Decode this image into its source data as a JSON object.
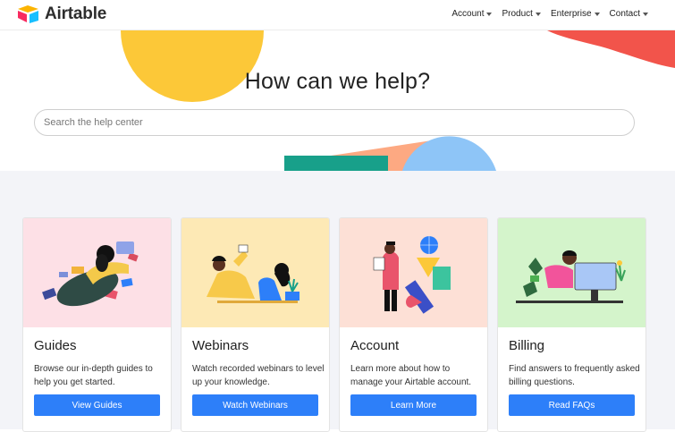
{
  "brand": {
    "name": "Airtable"
  },
  "nav": {
    "items": [
      {
        "label": "Account"
      },
      {
        "label": "Product"
      },
      {
        "label": "Enterprise"
      },
      {
        "label": "Contact"
      }
    ]
  },
  "hero": {
    "title": "How can we help?",
    "search_placeholder": "Search the help center",
    "search_value": ""
  },
  "cards": [
    {
      "title": "Guides",
      "description": "Browse our in-depth guides to help you get started.",
      "button": "View Guides",
      "bg": "#fde0e6",
      "icon": "reading-illustration"
    },
    {
      "title": "Webinars",
      "description": "Watch recorded webinars to level up your knowledge.",
      "button": "Watch Webinars",
      "bg": "#fde9b5",
      "icon": "webinar-illustration"
    },
    {
      "title": "Account",
      "description": "Learn more about how to manage your Airtable account.",
      "button": "Learn More",
      "bg": "#fde0d6",
      "icon": "account-illustration"
    },
    {
      "title": "Billing",
      "description": "Find answers to frequently asked billing questions.",
      "button": "Read FAQs",
      "bg": "#d4f4cb",
      "icon": "billing-illustration"
    }
  ],
  "colors": {
    "accent": "#2d7ff9",
    "hero_yellow": "#fcc838",
    "hero_red": "#f2544b",
    "hero_peach": "#fda982",
    "hero_teal": "#18a08a",
    "hero_blue": "#8ec5f7"
  }
}
